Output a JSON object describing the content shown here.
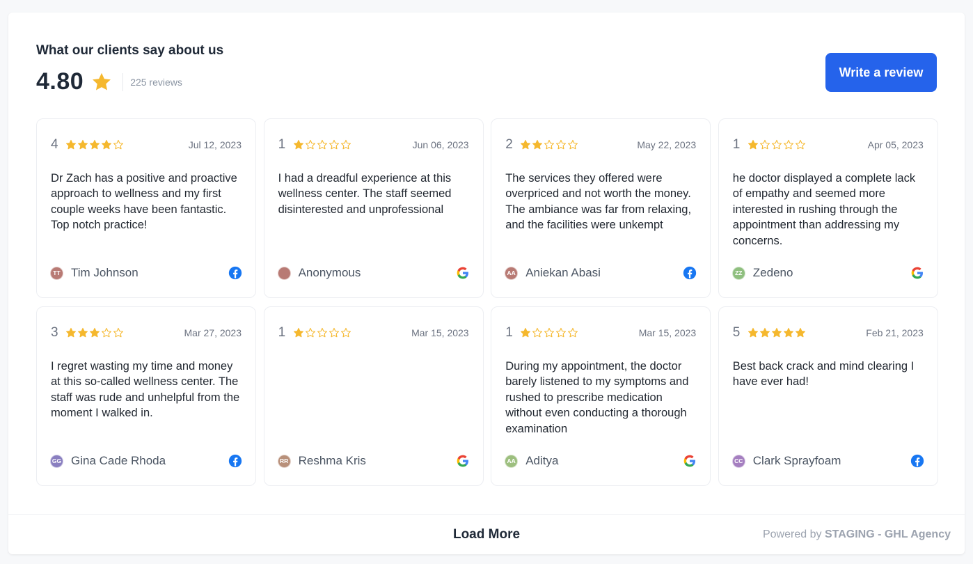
{
  "header": {
    "title": "What our clients say about us",
    "average": "4.80",
    "review_count": "225 reviews",
    "write_button": "Write a review"
  },
  "colors": {
    "accent": "#2563eb",
    "star": "#f5b82e",
    "facebook": "#1877f2"
  },
  "reviews": [
    {
      "score": "4",
      "stars": 4,
      "date": "Jul 12, 2023",
      "text": "Dr Zach has a positive and proactive approach to wellness and my first couple weeks have been fantastic. Top notch practice!",
      "initials": "TT",
      "author": "Tim Johnson",
      "avatar_color": "#b87a74",
      "source": "facebook"
    },
    {
      "score": "1",
      "stars": 1,
      "date": "Jun 06, 2023",
      "text": "I had a dreadful experience at this wellness center. The staff seemed disinterested and unprofessional",
      "initials": "",
      "author": "Anonymous",
      "avatar_color": "#b87a74",
      "source": "google"
    },
    {
      "score": "2",
      "stars": 2,
      "date": "May 22, 2023",
      "text": "The services they offered were overpriced and not worth the money. The ambiance was far from relaxing, and the facilities were unkempt",
      "initials": "AA",
      "author": "Aniekan Abasi",
      "avatar_color": "#b87a74",
      "source": "facebook"
    },
    {
      "score": "1",
      "stars": 1,
      "date": "Apr 05, 2023",
      "text": "he doctor displayed a complete lack of empathy and seemed more interested in rushing through the appointment than addressing my concerns.",
      "initials": "ZZ",
      "author": "Zedeno",
      "avatar_color": "#8fbf7f",
      "source": "google"
    },
    {
      "score": "3",
      "stars": 3,
      "date": "Mar 27, 2023",
      "text": "I regret wasting my time and money at this so-called wellness center. The staff was rude and unhelpful from the moment I walked in.",
      "initials": "GG",
      "author": "Gina Cade Rhoda",
      "avatar_color": "#8a7fc0",
      "source": "facebook"
    },
    {
      "score": "1",
      "stars": 1,
      "date": "Mar 15, 2023",
      "text": "",
      "initials": "RR",
      "author": "Reshma Kris",
      "avatar_color": "#b8907a",
      "source": "google"
    },
    {
      "score": "1",
      "stars": 1,
      "date": "Mar 15, 2023",
      "text": "During my appointment, the doctor barely listened to my symptoms and rushed to prescribe medication without even conducting a thorough examination",
      "initials": "AA",
      "author": "Aditya",
      "avatar_color": "#9dbf7f",
      "source": "google"
    },
    {
      "score": "5",
      "stars": 5,
      "date": "Feb 21, 2023",
      "text": "Best back crack and mind clearing I have ever had!",
      "initials": "CC",
      "author": "Clark Sprayfoam",
      "avatar_color": "#a57fc0",
      "source": "facebook"
    }
  ],
  "footer": {
    "load_more": "Load More",
    "powered_prefix": "Powered by",
    "powered_brand": "STAGING - GHL Agency"
  }
}
